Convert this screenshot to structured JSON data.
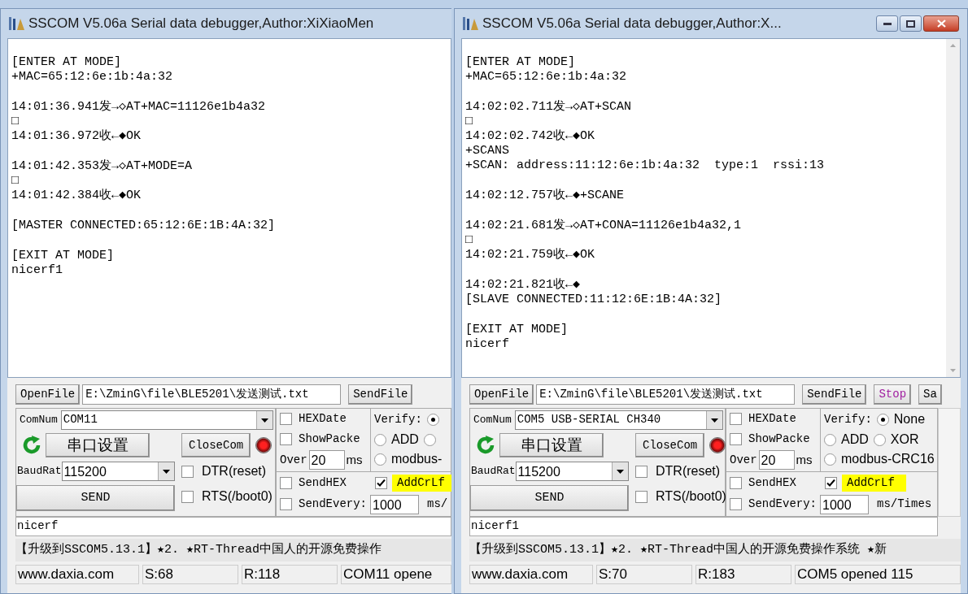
{
  "windows": [
    {
      "title": "SSCOM V5.06a Serial data debugger,Author:XiXiaoMen",
      "log": [
        [
          "[ENTER AT MODE]",
          "+MAC=65:12:6e:1b:4a:32"
        ],
        [
          "14:01:36.941发→◇AT+MAC=11126e1b4a32",
          "□",
          "14:01:36.972收←◆OK"
        ],
        [
          "14:01:42.353发→◇AT+MODE=A",
          "□",
          "14:01:42.384收←◆OK"
        ],
        [
          "[MASTER CONNECTED:65:12:6E:1B:4A:32]"
        ],
        [
          "[EXIT AT MODE]",
          "nicerf1"
        ]
      ],
      "file_bar": {
        "open_button": "OpenFile",
        "path": "E:\\ZminG\\file\\BLE5201\\发送测试.txt",
        "buttons": [
          {
            "label": "SendFile",
            "kind": "normal"
          }
        ]
      },
      "com_num": {
        "label": "ComNum",
        "value": "COM11"
      },
      "settings_button": "串口设置",
      "close_button": "CloseCom",
      "baud": {
        "label": "BaudRat",
        "value": "115200"
      },
      "send_button": "SEND",
      "dtr": {
        "label": "DTR(reset)",
        "checked": false
      },
      "rts": {
        "label": "RTS(/boot0)",
        "checked": false
      },
      "hex_date": {
        "label": "HEXDate",
        "checked": false
      },
      "show_packet": {
        "label": "ShowPacke",
        "checked": false
      },
      "over": {
        "label": "Over",
        "value": "20",
        "unit": "ms"
      },
      "verify": {
        "label": "Verify:",
        "options": [
          {
            "selected": true
          },
          {
            "label": "ADD",
            "selected": false
          },
          {
            "selected": false
          },
          {
            "label": "modbus-",
            "selected": false
          }
        ]
      },
      "send_hex": {
        "label": "SendHEX",
        "checked": false
      },
      "add_crlf": {
        "label": "AddCrLf",
        "checked": true
      },
      "send_every": {
        "label": "SendEvery:",
        "checked": false,
        "value": "1000",
        "unit": "ms/"
      },
      "send_text": "nicerf",
      "ticker": "【升级到SSCOM5.13.1】★2. ★RT-Thread中国人的开源免费操作",
      "status": [
        "www.daxia.com",
        "S:68",
        "R:118",
        "COM11 opene"
      ]
    },
    {
      "title": "SSCOM V5.06a Serial data debugger,Author:X...",
      "log": [
        [
          "[ENTER AT MODE]",
          "+MAC=65:12:6e:1b:4a:32"
        ],
        [
          "14:02:02.711发→◇AT+SCAN",
          "□",
          "14:02:02.742收←◆OK",
          "+SCANS",
          "+SCAN: address:11:12:6e:1b:4a:32  type:1  rssi:13"
        ],
        [
          "14:02:12.757收←◆+SCANE"
        ],
        [
          "14:02:21.681发→◇AT+CONA=11126e1b4a32,1",
          "□",
          "14:02:21.759收←◆OK"
        ],
        [
          "14:02:21.821收←◆",
          "[SLAVE CONNECTED:11:12:6E:1B:4A:32]"
        ],
        [
          "[EXIT AT MODE]",
          "nicerf"
        ]
      ],
      "file_bar": {
        "open_button": "OpenFile",
        "path": "E:\\ZminG\\file\\BLE5201\\发送测试.txt",
        "buttons": [
          {
            "label": "SendFile",
            "kind": "normal"
          },
          {
            "label": "Stop",
            "kind": "accent"
          },
          {
            "label": "Sa",
            "kind": "normal"
          }
        ]
      },
      "com_num": {
        "label": "ComNum",
        "value": "COM5 USB-SERIAL CH340"
      },
      "settings_button": "串口设置",
      "close_button": "CloseCom",
      "baud": {
        "label": "BaudRat",
        "value": "115200"
      },
      "send_button": "SEND",
      "dtr": {
        "label": "DTR(reset)",
        "checked": false
      },
      "rts": {
        "label": "RTS(/boot0)",
        "checked": false
      },
      "hex_date": {
        "label": "HEXDate",
        "checked": false
      },
      "show_packet": {
        "label": "ShowPacke",
        "checked": false
      },
      "over": {
        "label": "Over",
        "value": "20",
        "unit": "ms"
      },
      "verify": {
        "label": "Verify:",
        "options": [
          {
            "label": "None",
            "selected": true
          },
          {
            "label": "ADD",
            "selected": false
          },
          {
            "label": "XOR",
            "selected": false
          },
          {
            "label": "modbus-CRC16",
            "selected": false
          }
        ]
      },
      "send_hex": {
        "label": "SendHEX",
        "checked": false
      },
      "add_crlf": {
        "label": "AddCrLf",
        "checked": true
      },
      "send_every": {
        "label": "SendEvery:",
        "checked": false,
        "value": "1000",
        "unit": "ms/Times"
      },
      "send_text": "nicerf1",
      "ticker": "【升级到SSCOM5.13.1】★2. ★RT-Thread中国人的开源免费操作系统 ★新",
      "status": [
        "www.daxia.com",
        "S:70",
        "R:183",
        "COM5 opened 115"
      ]
    }
  ]
}
